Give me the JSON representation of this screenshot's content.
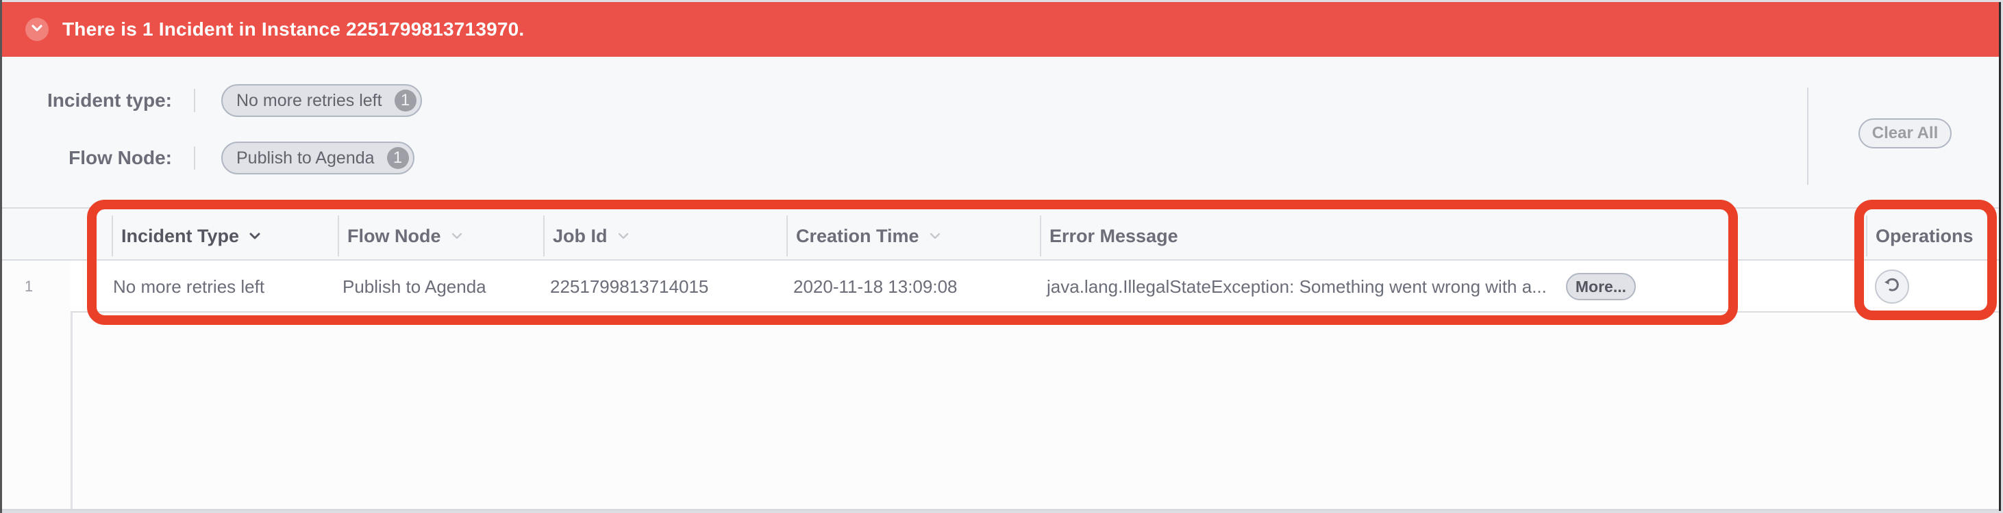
{
  "banner": {
    "title": "There is 1 Incident in Instance 2251799813713970.",
    "toggle_icon": "chevron-down-icon",
    "color": "#ec5149"
  },
  "filters": {
    "incident_type": {
      "label": "Incident type:",
      "pills": [
        {
          "label": "No more retries left",
          "count": "1"
        }
      ]
    },
    "flow_node": {
      "label": "Flow Node:",
      "pills": [
        {
          "label": "Publish to Agenda",
          "count": "1"
        }
      ]
    },
    "clear_all_label": "Clear All"
  },
  "table": {
    "columns": [
      {
        "label": "Incident Type",
        "sortable": true,
        "active": true
      },
      {
        "label": "Flow Node",
        "sortable": true,
        "active": false
      },
      {
        "label": "Job Id",
        "sortable": true,
        "active": false
      },
      {
        "label": "Creation Time",
        "sortable": true,
        "active": false
      },
      {
        "label": "Error Message",
        "sortable": false,
        "active": false
      },
      {
        "label": "Operations",
        "sortable": false,
        "active": false
      }
    ],
    "rows": [
      {
        "index": "1",
        "incident_type": "No more retries left",
        "flow_node": "Publish to Agenda",
        "job_id": "2251799813714015",
        "creation_time": "2020-11-18 13:09:08",
        "error_message": "java.lang.IllegalStateException: Something went wrong with a...",
        "more_label": "More...",
        "operation_icon": "retry-icon"
      }
    ]
  },
  "annotation_color": "#ea4027"
}
